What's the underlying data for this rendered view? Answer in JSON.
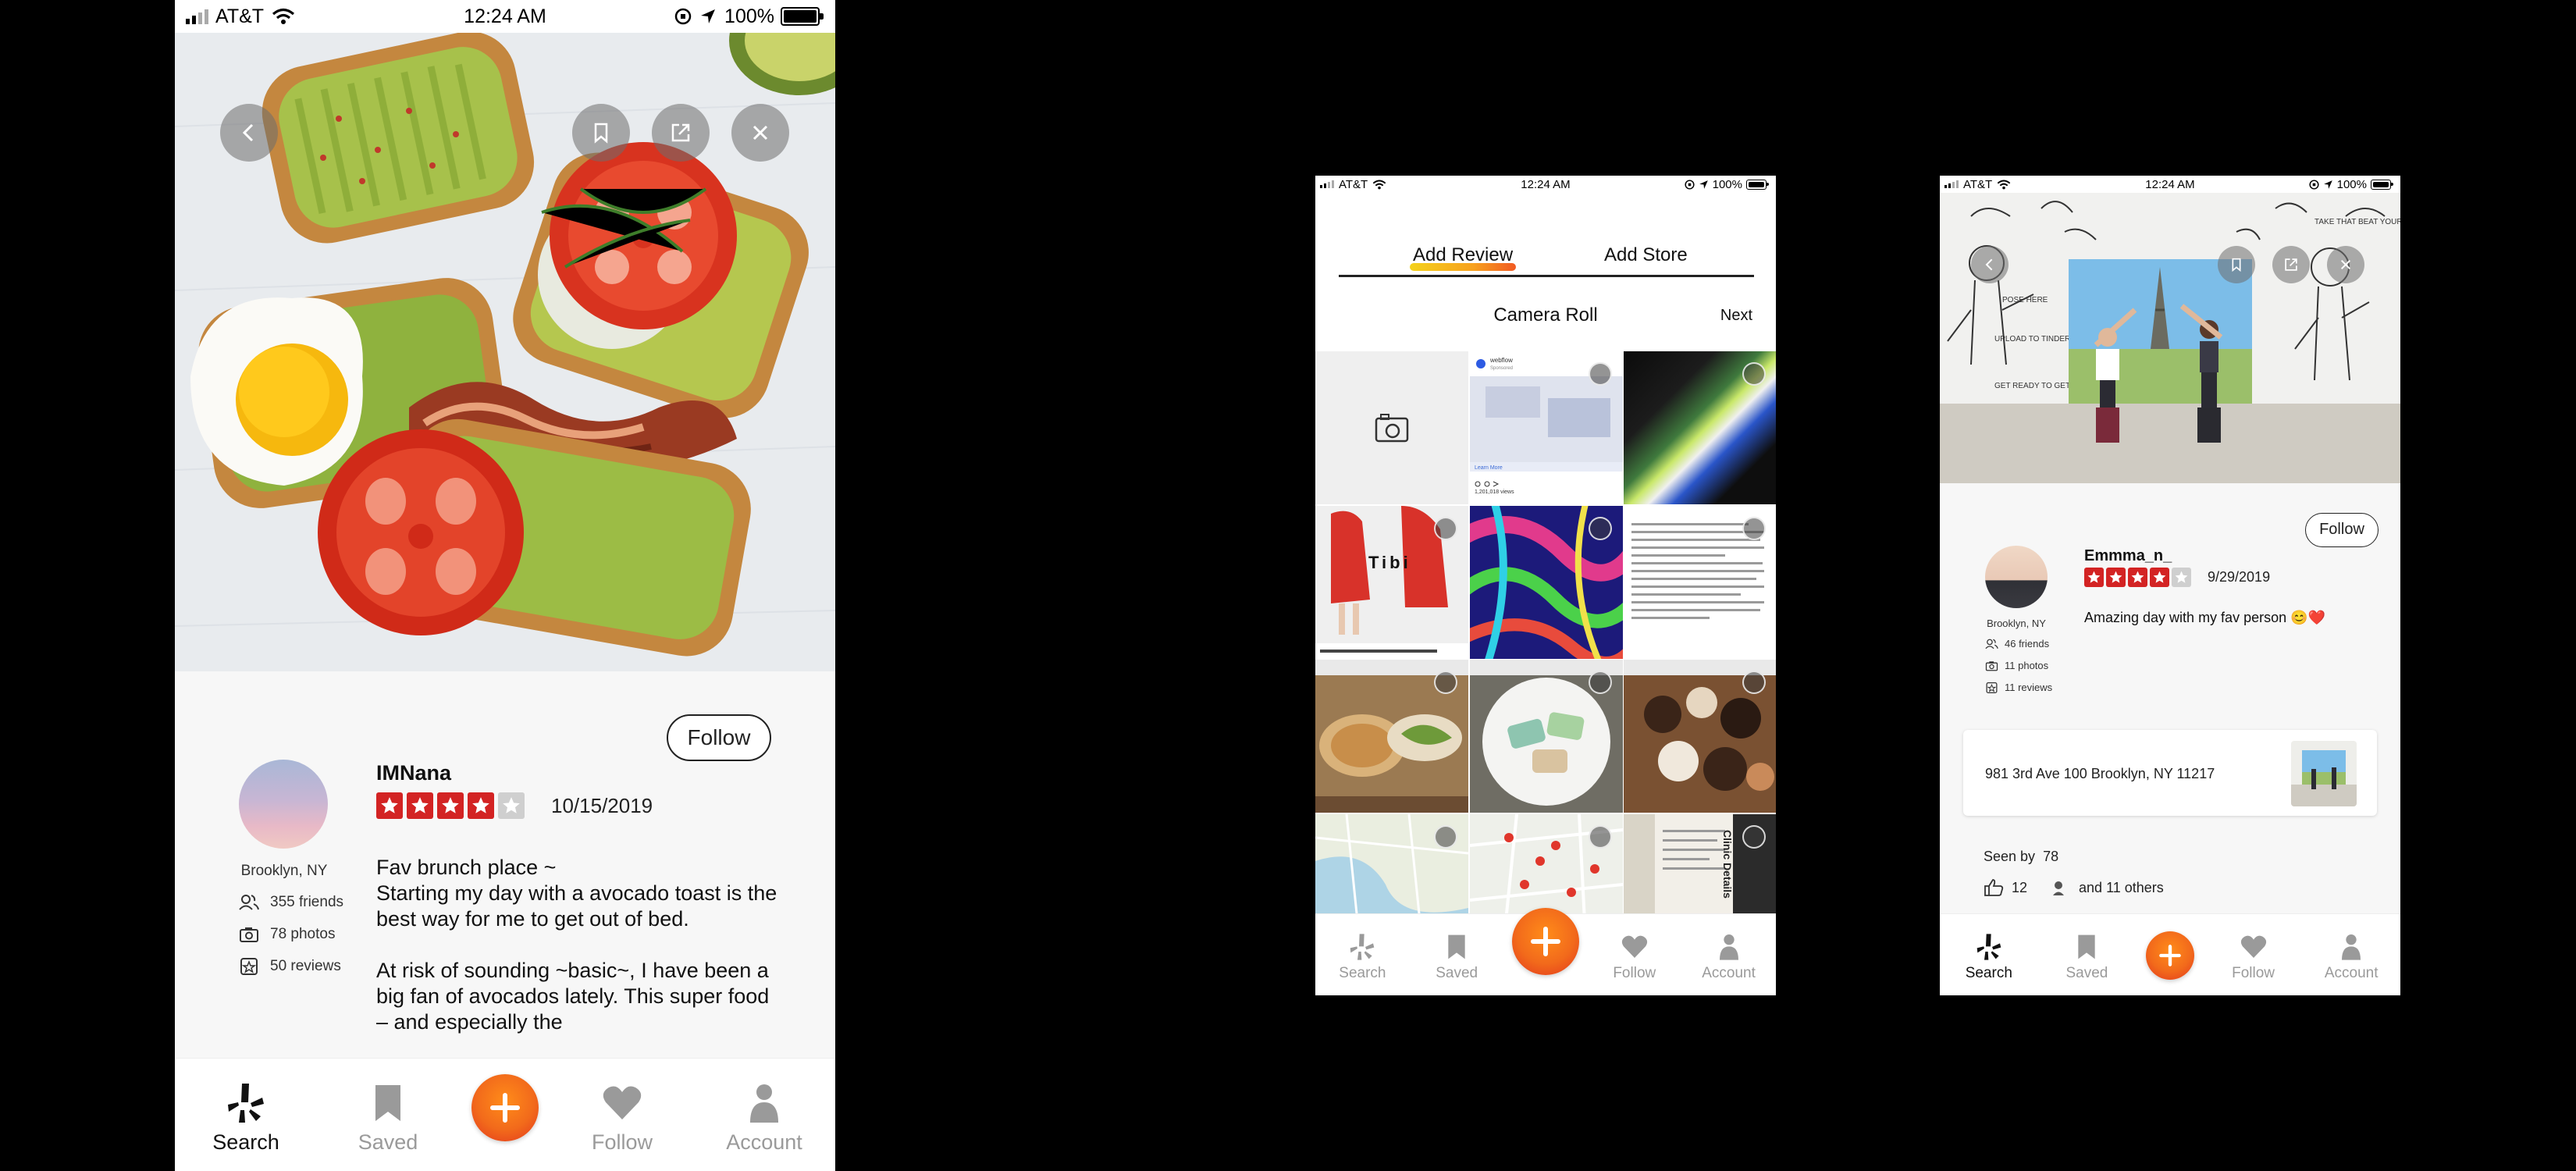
{
  "status": {
    "carrier": "AT&T",
    "time": "12:24 AM",
    "battery": "100%",
    "battery_level": 1.0
  },
  "colors": {
    "accent_orange": "#f26a1b",
    "star_red": "#d32323",
    "tab_inactive": "#9a9a9a"
  },
  "tab_labels": {
    "search": "Search",
    "saved": "Saved",
    "follow": "Follow",
    "account": "Account"
  },
  "screen1": {
    "follow_label": "Follow",
    "user": {
      "name": "IMNana",
      "location": "Brooklyn, NY",
      "friends": "355 friends",
      "photos": "78 photos",
      "reviews": "50 reviews"
    },
    "rating": 4,
    "date": "10/15/2019",
    "review": [
      "Fav brunch place ~",
      "Starting my day with a avocado toast is the best way for me to get out of bed.",
      "At risk of sounding ~basic~, I have been a big fan of avocados lately. This super food – and especially the"
    ],
    "overlay_icons": [
      "back-icon",
      "bookmark-icon",
      "share-icon",
      "close-icon"
    ]
  },
  "screen2": {
    "tab_add_review": "Add Review",
    "tab_add_store": "Add Store",
    "title": "Camera Roll",
    "next": "Next",
    "photos": [
      "camera",
      "ad-screenshot",
      "abstract-gradient",
      "fashion-red",
      "colorful-pattern",
      "chinese-text",
      "food-1",
      "food-2",
      "food-3",
      "map-1",
      "map-2",
      "document"
    ],
    "thumb_text": {
      "tibi": "Tibi",
      "brand": "webflow",
      "sponsored": "Sponsored",
      "learn_more": "Learn More",
      "views": "1,201,018 views",
      "doc_title": "Clinic Details"
    }
  },
  "screen3": {
    "follow_label": "Follow",
    "user": {
      "name": "Emmma_n_",
      "location": "Brooklyn, NY",
      "friends": "46 friends",
      "photos": "11 photos",
      "reviews": "11 reviews"
    },
    "rating": 4,
    "date": "9/29/2019",
    "review": "Amazing day with my fav person 😊❤️",
    "address": "981 3rd Ave 100 Brooklyn, NY  11217",
    "seen_by_label": "Seen by",
    "seen_by_count": "78",
    "likes": "12",
    "others": "and 11 others",
    "mural_text": [
      "POSE HERE",
      "UPLOAD TO TINDER",
      "GET READY TO GET MATCHED",
      "TAKE THAT BEAT YOUR BATHROOM SELFIE"
    ]
  }
}
